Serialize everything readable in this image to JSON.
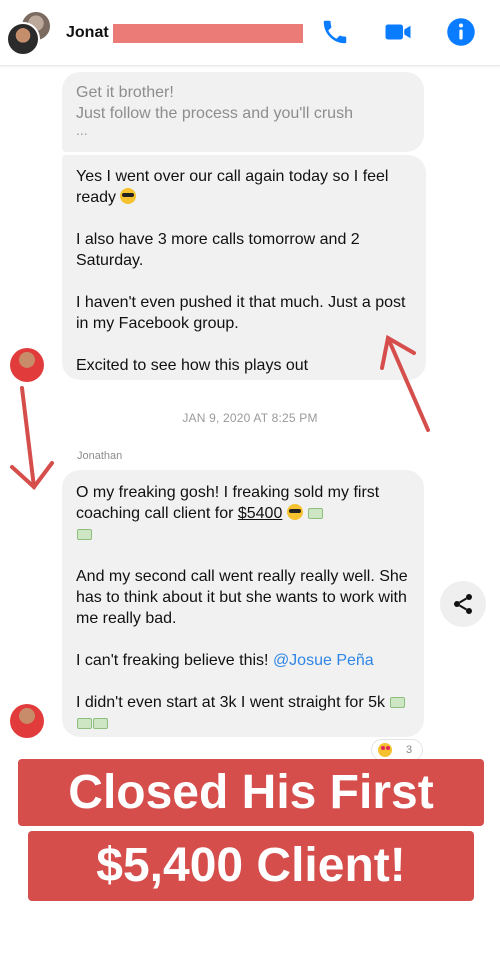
{
  "header": {
    "contact_name_visible": "Jonat",
    "icons": [
      "phone-icon",
      "video-camera-icon",
      "info-icon"
    ],
    "accent_color": "#0a7cff"
  },
  "messages": {
    "faded_bubble": {
      "line1": "Get it brother!",
      "line2": "Just follow the process and you'll crush",
      "dots": "..."
    },
    "bubble1": {
      "p1": "Yes I went over our call again today so I feel ready",
      "p2": "I also have 3 more calls tomorrow and 2 Saturday.",
      "p3": "I haven't even pushed it that much. Just a post in my Facebook group.",
      "p4": "Excited to see how this plays out"
    },
    "timestamp": "JAN 9, 2020 AT 8:25 PM",
    "sender": "Jonathan",
    "bubble2": {
      "p1_a": "O my freaking gosh! I freaking sold my first coaching call client for ",
      "p1_amount": "$5400",
      "p2": "And my second call went really really well. She has to think about it but she wants to work with me really bad.",
      "p3_a": "I can't freaking believe this! ",
      "p3_mention": "@Josue Peña",
      "p4": "I didn't even start at 3k I went straight for 5k"
    },
    "reaction_count": "3"
  },
  "banners": {
    "line1": "Closed His First",
    "line2": "$5,400 Client!",
    "color": "#d54e4c"
  }
}
